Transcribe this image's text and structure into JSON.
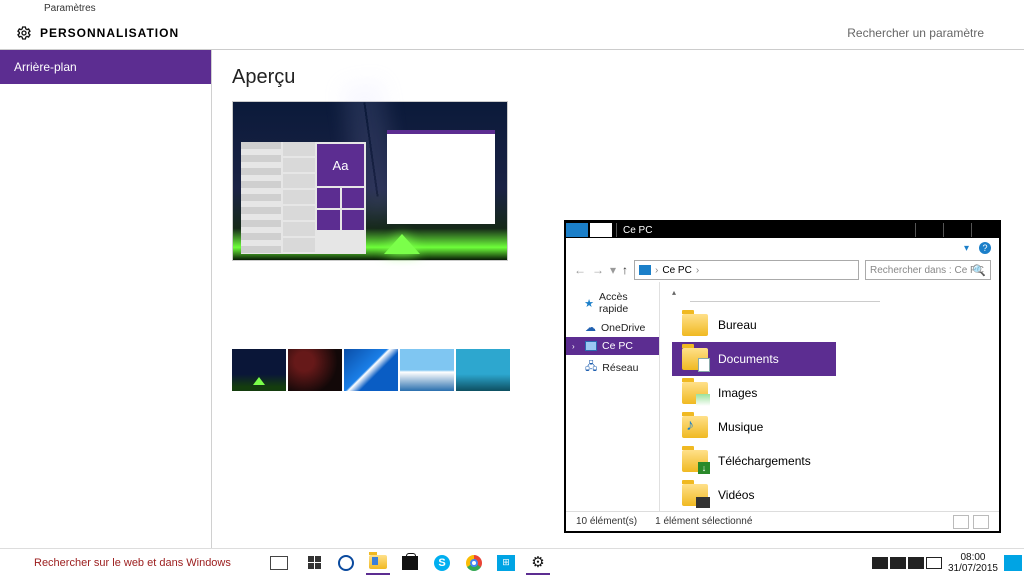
{
  "settings": {
    "window_label": "Paramètres",
    "title": "PERSONNALISATION",
    "search_placeholder": "Rechercher un paramètre",
    "sidebar": {
      "items": [
        {
          "label": "Arrière-plan"
        }
      ]
    },
    "content": {
      "heading": "Aperçu",
      "preview_sample_text": "Aa"
    }
  },
  "explorer": {
    "title": "Ce PC",
    "breadcrumb": {
      "root": "",
      "current": "Ce PC"
    },
    "search_placeholder": "Rechercher dans : Ce PC",
    "nav": [
      {
        "label": "Accès rapide",
        "icon": "star"
      },
      {
        "label": "OneDrive",
        "icon": "cloud"
      },
      {
        "label": "Ce PC",
        "icon": "pc",
        "selected": true
      },
      {
        "label": "Réseau",
        "icon": "net"
      }
    ],
    "folders": [
      {
        "label": "Bureau",
        "kind": "desk"
      },
      {
        "label": "Documents",
        "kind": "doc",
        "selected": true
      },
      {
        "label": "Images",
        "kind": "img"
      },
      {
        "label": "Musique",
        "kind": "mus"
      },
      {
        "label": "Téléchargements",
        "kind": "dl"
      },
      {
        "label": "Vidéos",
        "kind": "vid"
      }
    ],
    "status": {
      "count": "10 élément(s)",
      "selection": "1 élément sélectionné"
    }
  },
  "taskbar": {
    "search_placeholder": "Rechercher sur le web et dans Windows",
    "clock": {
      "time": "08:00",
      "date": "31/07/2015"
    }
  }
}
